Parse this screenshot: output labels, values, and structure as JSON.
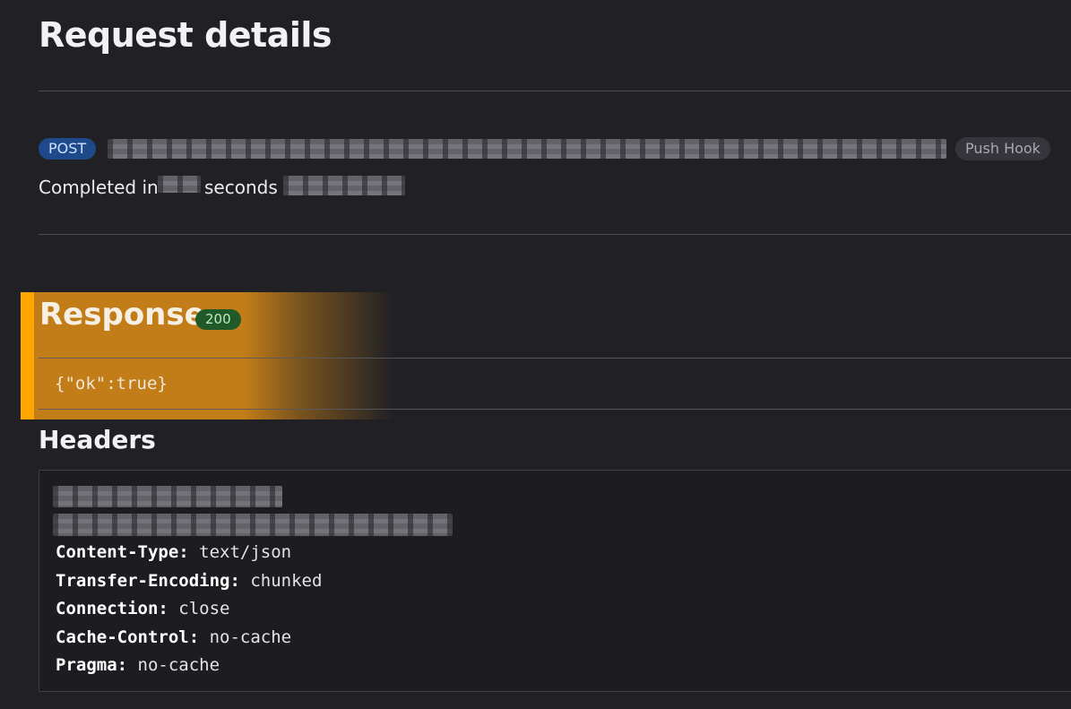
{
  "page": {
    "title": "Request details"
  },
  "request": {
    "method": "POST",
    "hook_type": "Push Hook",
    "completed_prefix": "Completed in",
    "completed_suffix": "seconds"
  },
  "response": {
    "title": "Response",
    "status_code": "200",
    "body": "{\"ok\":true}"
  },
  "headers": {
    "title": "Headers",
    "items": [
      {
        "key": "Content-Type:",
        "value": "text/json"
      },
      {
        "key": "Transfer-Encoding:",
        "value": "chunked"
      },
      {
        "key": "Connection:",
        "value": "close"
      },
      {
        "key": "Cache-Control:",
        "value": "no-cache"
      },
      {
        "key": "Pragma:",
        "value": "no-cache"
      }
    ]
  },
  "colors": {
    "background": "#212125",
    "method_badge": "#1e4a8c",
    "status_badge": "#1f5a28",
    "highlight": "#c27d19",
    "highlight_bar": "#ffa500"
  }
}
